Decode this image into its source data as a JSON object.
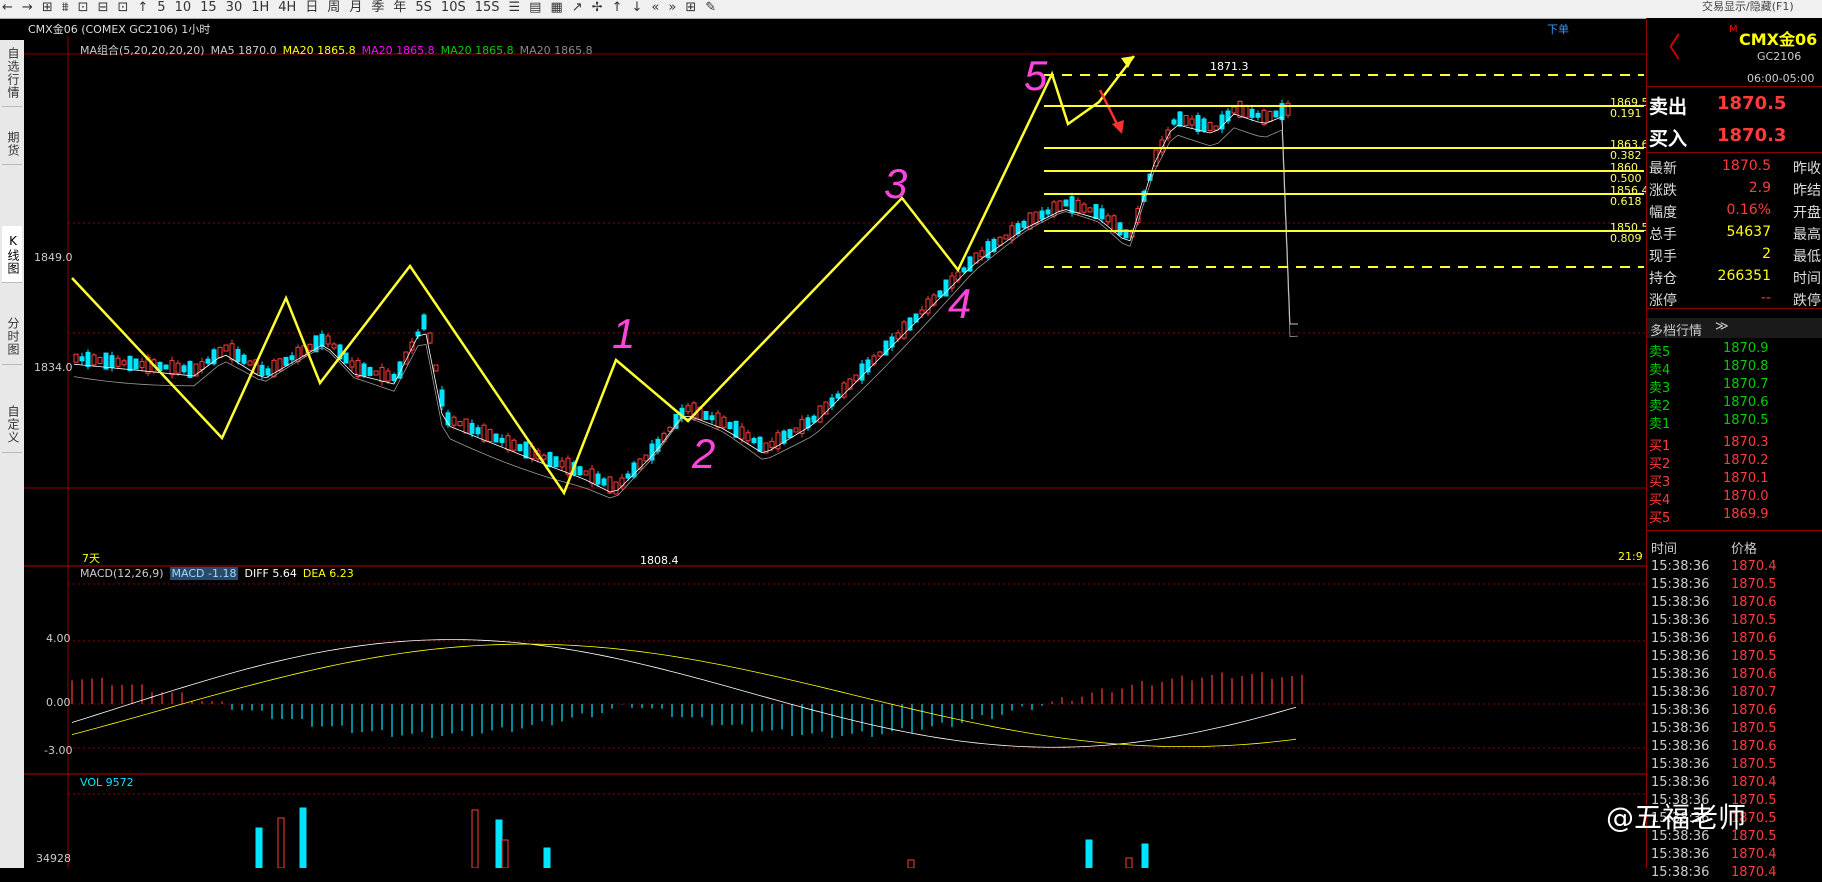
{
  "toolbar": {
    "icons": [
      "←",
      "→",
      "⊞",
      "⩩",
      "⊡",
      "⊟",
      "⊡",
      "↑",
      "5",
      "10",
      "15",
      "30",
      "1H",
      "4H",
      "日",
      "周",
      "月",
      "季",
      "年",
      "5S",
      "10S",
      "15S",
      "☰",
      "▤",
      "▦",
      "↗",
      "✢",
      "↑",
      "↓",
      "«",
      "»",
      "⊞",
      "✎"
    ],
    "right_text": "交易显示/隐藏(F1)"
  },
  "sidebar": {
    "tabs": [
      "自选行情",
      "期货",
      "K线图",
      "分时图",
      "自定义"
    ]
  },
  "chart": {
    "symbol_title": "CMX金06 (COMEX GC2106) 1小时",
    "order_button": "下单",
    "ma_legend": [
      {
        "text": "MA组合(5,20,20,20,20)",
        "color": "#cccccc"
      },
      {
        "text": "MA5 1870.0",
        "color": "#cccccc"
      },
      {
        "text": "MA20 1865.8",
        "color": "#ffff00"
      },
      {
        "text": "MA20 1865.8",
        "color": "#ff00ff"
      },
      {
        "text": "MA20 1865.8",
        "color": "#00cc00"
      },
      {
        "text": "MA20 1865.8",
        "color": "#888888"
      }
    ],
    "price_axis": [
      "1849.0",
      "1834.0"
    ],
    "high_label": "1871.3",
    "low_label": "1808.4",
    "period_label": "7天",
    "time_label": "21:9",
    "fib_levels": [
      {
        "price": "1869.5",
        "ratio": "0.191"
      },
      {
        "price": "1863.6",
        "ratio": "0.382"
      },
      {
        "price": "1860",
        "ratio": "0.500"
      },
      {
        "price": "1856.4",
        "ratio": "0.618"
      },
      {
        "price": "1850.5",
        "ratio": "0.809"
      }
    ],
    "wave_labels": [
      "1",
      "2",
      "3",
      "4",
      "5"
    ],
    "macd_legend": [
      {
        "text": "MACD(12,26,9)",
        "color": "#cccccc"
      },
      {
        "text": "MACD -1.18",
        "color": "#a0d8ff"
      },
      {
        "text": "DIFF 5.64",
        "color": "#ffffff"
      },
      {
        "text": "DEA 6.23",
        "color": "#ffff00"
      }
    ],
    "macd_axis": [
      "4.00",
      "0.00",
      "-3.00"
    ],
    "vol_legend": "VOL 9572",
    "vol_axis": "34928",
    "colors": {
      "up": "#ff3b3b",
      "down": "#00e5ff",
      "wave": "#ffff33",
      "annot": "#ff44dd",
      "grid": "#8b0000"
    }
  },
  "panel": {
    "symbol": "CMX金06",
    "code": "GC2106",
    "session": "06:00-05:00",
    "sell_label": "卖出",
    "sell_price": "1870.5",
    "buy_label": "买入",
    "buy_price": "1870.3",
    "stats": [
      {
        "label": "最新",
        "value": "1870.5",
        "value_color": "#ff3b3b",
        "label2": "昨收"
      },
      {
        "label": "涨跌",
        "value": "2.9",
        "value_color": "#ff3b3b",
        "label2": "昨结"
      },
      {
        "label": "幅度",
        "value": "0.16%",
        "value_color": "#ff3b3b",
        "label2": "开盘"
      },
      {
        "label": "总手",
        "value": "54637",
        "value_color": "#ffff00",
        "label2": "最高"
      },
      {
        "label": "现手",
        "value": "2",
        "value_color": "#ffff00",
        "label2": "最低"
      },
      {
        "label": "持仓",
        "value": "266351",
        "value_color": "#ffff00",
        "label2": "时间"
      },
      {
        "label": "涨停",
        "value": "--",
        "value_color": "#ff3b3b",
        "label2": "跌停"
      }
    ],
    "depth_title": "多档行情",
    "asks": [
      {
        "label": "卖5",
        "price": "1870.9"
      },
      {
        "label": "卖4",
        "price": "1870.8"
      },
      {
        "label": "卖3",
        "price": "1870.7"
      },
      {
        "label": "卖2",
        "price": "1870.6"
      },
      {
        "label": "卖1",
        "price": "1870.5"
      }
    ],
    "bids": [
      {
        "label": "买1",
        "price": "1870.3"
      },
      {
        "label": "买2",
        "price": "1870.2"
      },
      {
        "label": "买3",
        "price": "1870.1"
      },
      {
        "label": "买4",
        "price": "1870.0"
      },
      {
        "label": "买5",
        "price": "1869.9"
      }
    ],
    "tick_header": {
      "time": "时间",
      "price": "价格"
    },
    "ticks": [
      {
        "time": "15:38:36",
        "price": "1870.4"
      },
      {
        "time": "15:38:36",
        "price": "1870.5"
      },
      {
        "time": "15:38:36",
        "price": "1870.6"
      },
      {
        "time": "15:38:36",
        "price": "1870.5"
      },
      {
        "time": "15:38:36",
        "price": "1870.6"
      },
      {
        "time": "15:38:36",
        "price": "1870.5"
      },
      {
        "time": "15:38:36",
        "price": "1870.6"
      },
      {
        "time": "15:38:36",
        "price": "1870.7"
      },
      {
        "time": "15:38:36",
        "price": "1870.6"
      },
      {
        "time": "15:38:36",
        "price": "1870.5"
      },
      {
        "time": "15:38:36",
        "price": "1870.6"
      },
      {
        "time": "15:38:36",
        "price": "1870.5"
      },
      {
        "time": "15:38:36",
        "price": "1870.4"
      },
      {
        "time": "15:38:36",
        "price": "1870.5"
      },
      {
        "time": "15:38:36",
        "price": "1870.5"
      },
      {
        "time": "15:38:36",
        "price": "1870.5"
      },
      {
        "time": "15:38:36",
        "price": "1870.4"
      },
      {
        "time": "15:38:36",
        "price": "1870.4"
      }
    ]
  },
  "watermark": "@五福老师"
}
